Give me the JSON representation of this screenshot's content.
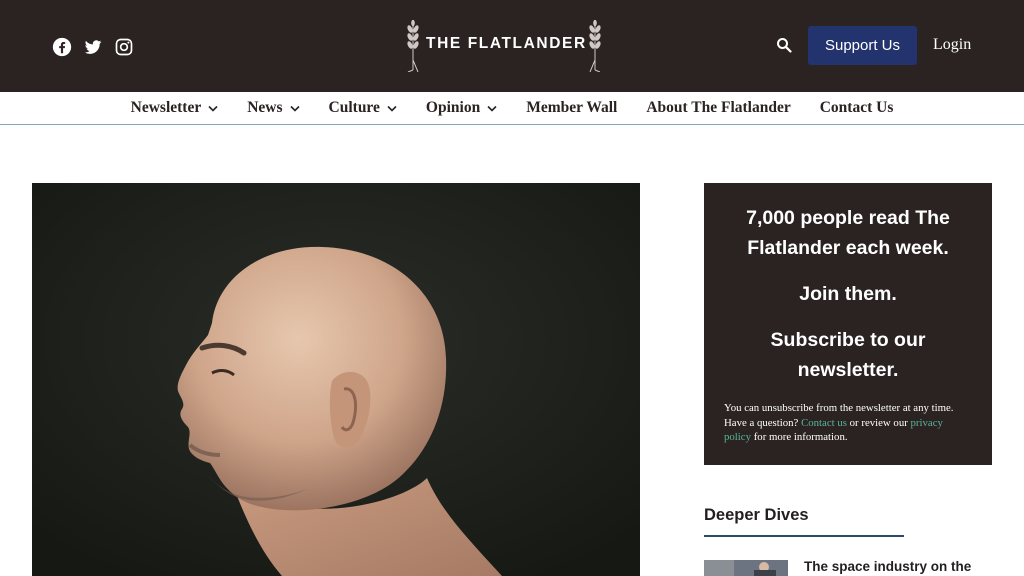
{
  "header": {
    "social": [
      {
        "icon": "facebook-icon"
      },
      {
        "icon": "twitter-icon"
      },
      {
        "icon": "instagram-icon"
      }
    ],
    "logo_text": "THE FLATLANDER",
    "search_icon": "search-icon",
    "support_label": "Support Us",
    "login_label": "Login",
    "colors": {
      "bar": "#2b2322",
      "support": "#23336e"
    }
  },
  "nav": {
    "items": [
      {
        "label": "Newsletter",
        "dropdown": true
      },
      {
        "label": "News",
        "dropdown": true
      },
      {
        "label": "Culture",
        "dropdown": true
      },
      {
        "label": "Opinion",
        "dropdown": true
      },
      {
        "label": "Member Wall",
        "dropdown": false
      },
      {
        "label": "About The Flatlander",
        "dropdown": false
      },
      {
        "label": "Contact Us",
        "dropdown": false
      }
    ]
  },
  "promo": {
    "headline1": "7,000 people read The Flatlander each week.",
    "headline2": "Join them.",
    "headline3": "Subscribe to our newsletter.",
    "small_prefix": "You can unsubscribe from the newsletter at any time. Have a question? ",
    "contact_link": "Contact us",
    "small_mid": " or review our ",
    "privacy_link": "privacy policy",
    "small_suffix": " for more information.",
    "link_color": "#58b39a"
  },
  "deeper_dives": {
    "title": "Deeper Dives",
    "first_link": "The space industry on the"
  }
}
